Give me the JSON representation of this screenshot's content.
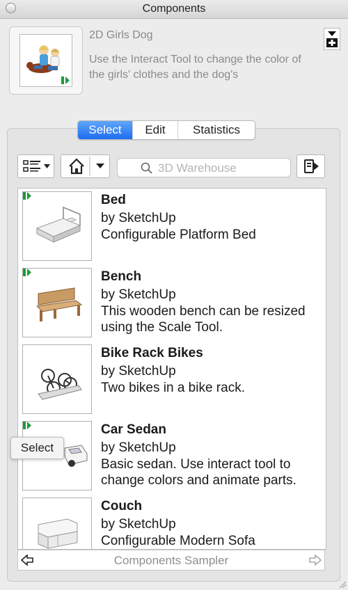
{
  "window": {
    "title": "Components"
  },
  "component": {
    "name": "2D Girls Dog",
    "description": "Use the Interact Tool to change the color of the girls' clothes and the dog's"
  },
  "tabs": [
    {
      "label": "Select",
      "active": true
    },
    {
      "label": "Edit",
      "active": false
    },
    {
      "label": "Statistics",
      "active": false
    }
  ],
  "toolbar": {
    "view_options_icon": "list-view-icon",
    "home_icon": "home-icon",
    "search_placeholder": "3D Warehouse",
    "search_icon": "search-icon",
    "details_icon": "details-arrow-icon"
  },
  "items": [
    {
      "name": "Bed",
      "author": "by SketchUp",
      "description": "Configurable Platform Bed",
      "dynamic": true
    },
    {
      "name": "Bench",
      "author": "by SketchUp",
      "description": "This wooden bench can be resized using the Scale Tool.",
      "dynamic": true
    },
    {
      "name": "Bike Rack Bikes",
      "author": "by SketchUp",
      "description": "Two bikes in a bike rack.",
      "dynamic": false
    },
    {
      "name": "Car Sedan",
      "author": "by SketchUp",
      "description": "Basic sedan.  Use interact tool to change colors and animate parts.",
      "dynamic": true
    },
    {
      "name": "Couch",
      "author": "by SketchUp",
      "description": "Configurable Modern Sofa",
      "dynamic": false
    }
  ],
  "footer": {
    "collection": "Components Sampler"
  },
  "tooltip": {
    "text": "Select"
  },
  "colors": {
    "accent": "#1f6cf3",
    "dynamic_badge": "#1e9a3a"
  }
}
